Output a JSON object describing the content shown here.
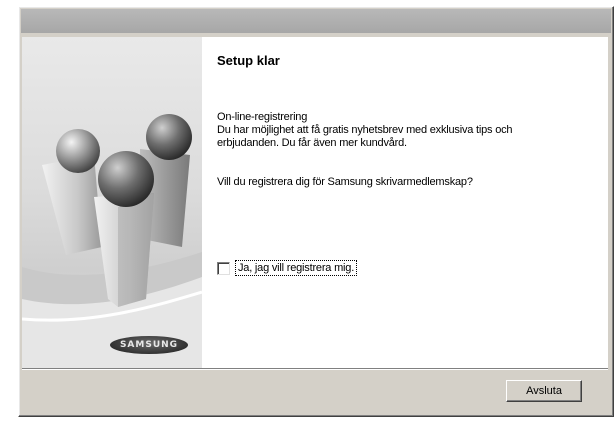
{
  "dialog": {
    "title": "Setup klar",
    "text_line1": "On-line-registrering",
    "text_line2": "Du har möjlighet att få gratis nyhetsbrev med exklusiva tips och",
    "text_line3": "erbjudanden. Du får även mer kundvård.",
    "question": "Vill du registrera dig för Samsung skrivarmedlemskap?",
    "checkbox_label": "Ja, jag vill registrera mig.",
    "checkbox_checked": false
  },
  "side_panel": {
    "brand_logo_text": "SAMSUNG"
  },
  "footer": {
    "exit_button_label": "Avsluta"
  },
  "colors": {
    "window_face": "#d4d0c8",
    "content_background": "#ffffff"
  }
}
